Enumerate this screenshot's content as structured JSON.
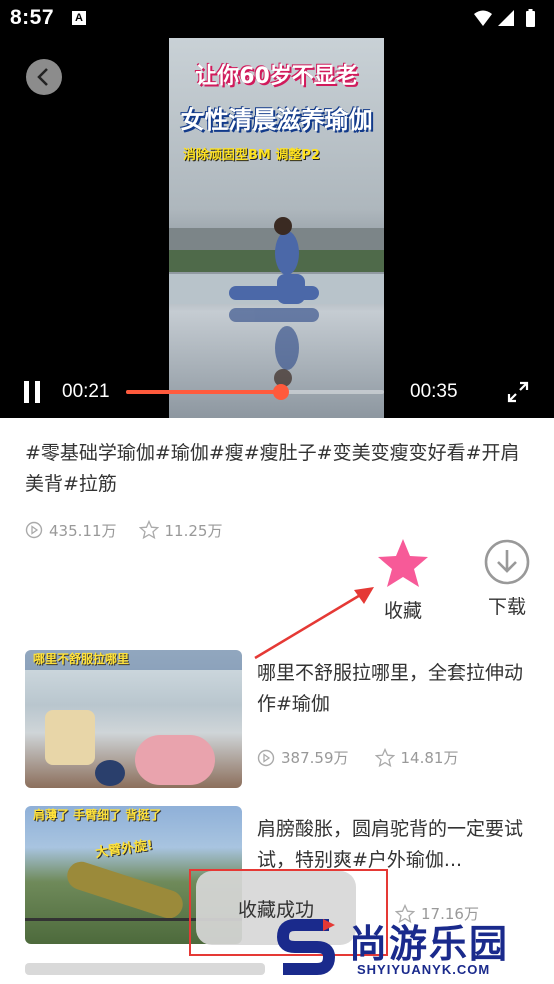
{
  "status_bar": {
    "time": "8:57",
    "notif_letter": "A"
  },
  "player": {
    "thumb_title_1": "让你60岁不显老",
    "thumb_title_2": "女性清晨滋养瑜伽",
    "thumb_title_3": "消除顽固型BM 调整P2",
    "current_time": "00:21",
    "total_time": "00:35",
    "progress": 0.6,
    "accent_color": "#ff5a3c"
  },
  "video": {
    "description": "#零基础学瑜伽#瑜伽#瘦#瘦肚子#变美变瘦变好看#开肩美背#拉筋",
    "plays": "435.11万",
    "favorites": "11.25万"
  },
  "actions": {
    "favorite_label": "收藏",
    "download_label": "下载",
    "favorite_color": "#f75a98"
  },
  "related": [
    {
      "thumb_text": "哪里不舒服拉哪里",
      "title": "哪里不舒服拉哪里，全套拉伸动作#瑜伽",
      "plays": "387.59万",
      "favorites": "14.81万"
    },
    {
      "thumb_text": "肩薄了 手臂细了 背挺了",
      "thumb_text_2": "大臂外旋!",
      "title": "肩膀酸胀，圆肩驼背的一定要试试，特别爽#户外瑜伽...",
      "plays": "",
      "favorites": "17.16万"
    }
  ],
  "toast": {
    "text": "收藏成功"
  },
  "watermark": {
    "cn": "尚游乐园",
    "en": "SHYIYUANYK.COM"
  },
  "icons": [
    "back-icon",
    "pause-icon",
    "fullscreen-icon",
    "play-count-icon",
    "star-outline-icon",
    "star-filled-icon",
    "download-icon",
    "wifi-icon",
    "signal-icon",
    "battery-icon"
  ]
}
